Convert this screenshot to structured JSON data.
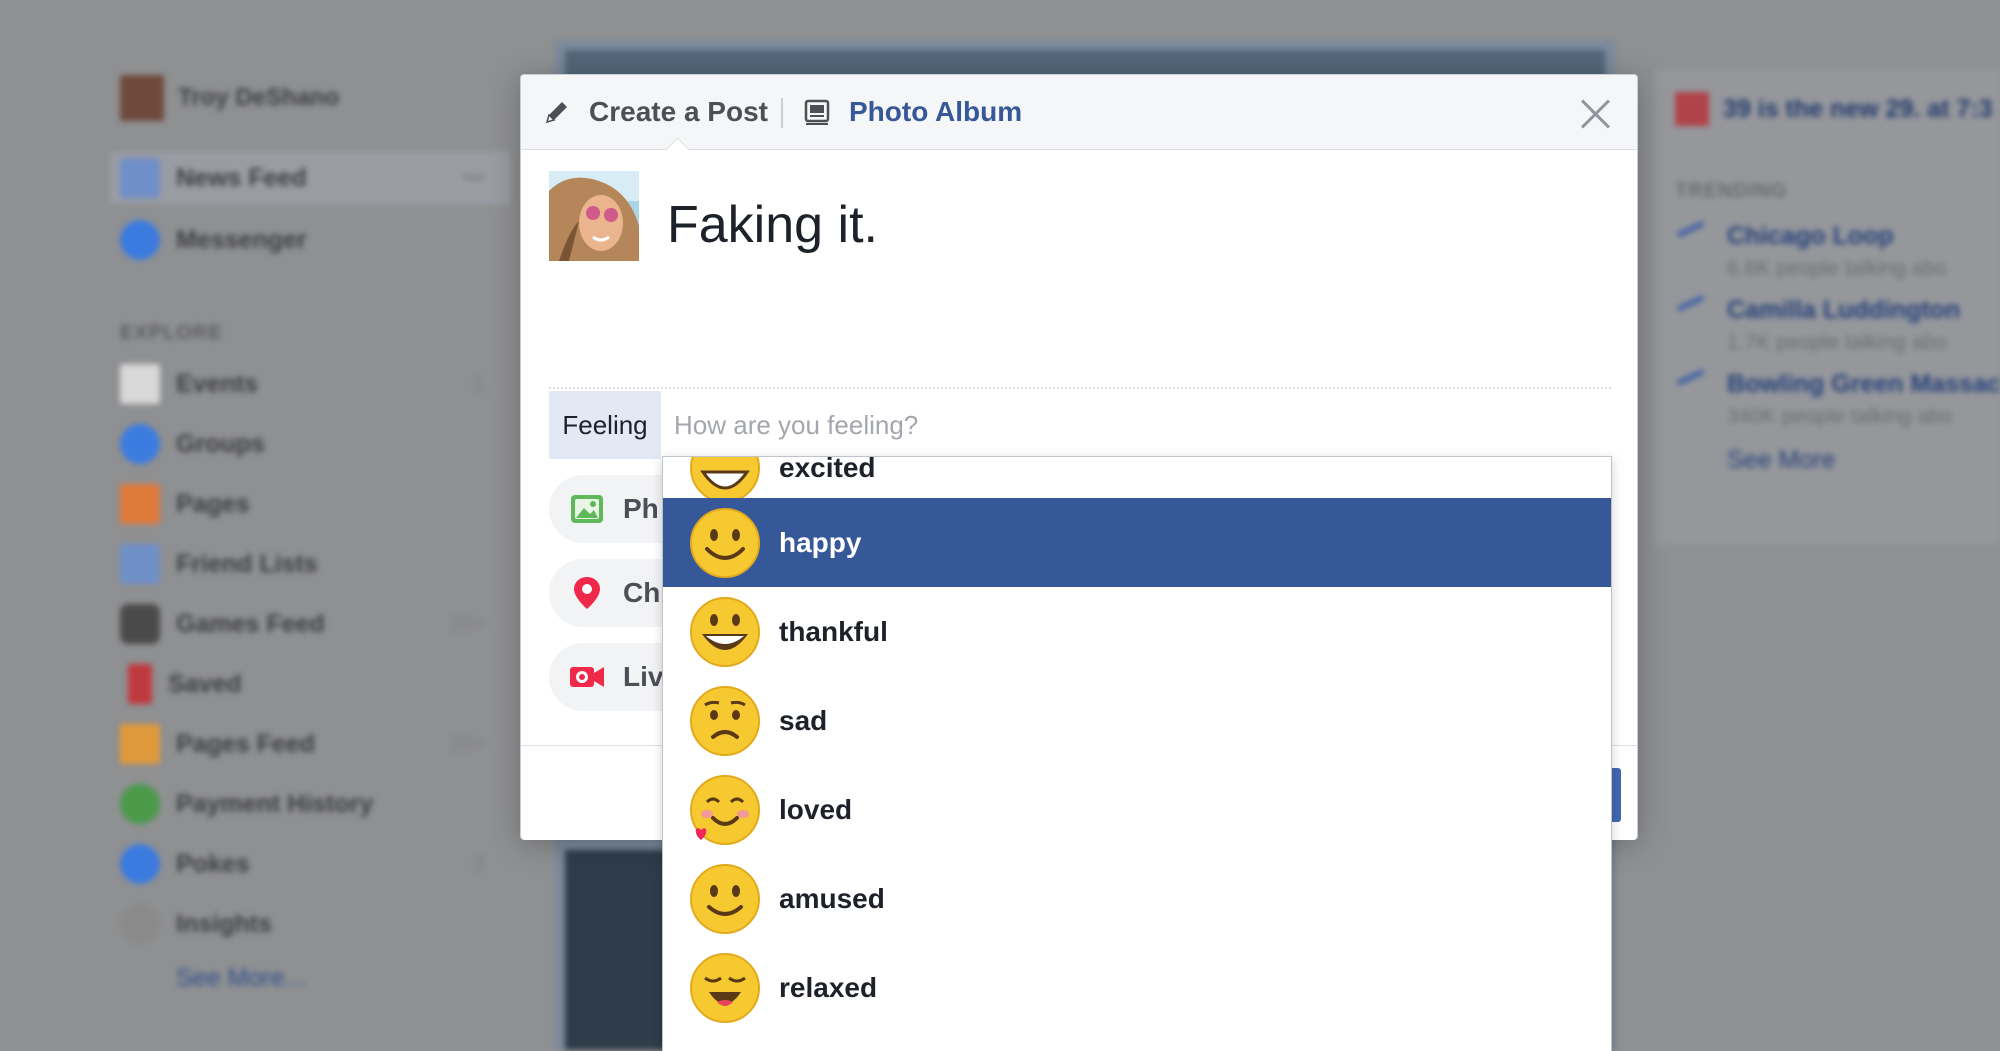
{
  "background": {
    "user_name": "Troy DeShano",
    "nav": [
      {
        "label": "News Feed",
        "count": "•••",
        "color": "#6f8fc8"
      },
      {
        "label": "Messenger",
        "count": "",
        "color": "#3b7be0"
      }
    ],
    "explore_heading": "EXPLORE",
    "explore": [
      {
        "label": "Events",
        "count": "1",
        "color": "#d8d8d8"
      },
      {
        "label": "Groups",
        "count": "",
        "color": "#3b7be0"
      },
      {
        "label": "Pages",
        "count": "",
        "color": "#e07a3b"
      },
      {
        "label": "Friend Lists",
        "count": "",
        "color": "#6f8fc8"
      },
      {
        "label": "Games Feed",
        "count": "20+",
        "color": "#4a4a4a"
      },
      {
        "label": "Saved",
        "count": "",
        "color": "#c0393f"
      },
      {
        "label": "Pages Feed",
        "count": "20+",
        "color": "#e09a3b"
      },
      {
        "label": "Payment History",
        "count": "",
        "color": "#4a9a4a"
      },
      {
        "label": "Pokes",
        "count": "3",
        "color": "#3b7be0"
      },
      {
        "label": "Insights",
        "count": "",
        "color": "#8a8a8a"
      }
    ],
    "see_more": "See More...",
    "event_text": "39 is the new 29. at 7:3",
    "trending_heading": "TRENDING",
    "trending": [
      {
        "title": "Chicago Loop",
        "sub": "6.8K people talking abo"
      },
      {
        "title": "Camilla Luddington",
        "sub": "1.7K people talking abo"
      },
      {
        "title": "Bowling Green Massac",
        "sub": "340K people talking abo"
      }
    ],
    "trending_see_more": "See More"
  },
  "dialog": {
    "tab_create": "Create a Post",
    "tab_album": "Photo Album",
    "composer_text": "Faking it.",
    "feeling_tag": "Feeling",
    "feeling_placeholder": "How are you feeling?",
    "pills": [
      {
        "label": "Ph",
        "icon": "photo-icon"
      },
      {
        "label": "Ch",
        "icon": "location-pin-icon"
      },
      {
        "label": "Liv",
        "icon": "live-video-icon"
      }
    ]
  },
  "dropdown": {
    "items": [
      {
        "label": "excited",
        "icon": "excited-emoji-icon"
      },
      {
        "label": "happy",
        "icon": "happy-emoji-icon",
        "selected": true
      },
      {
        "label": "thankful",
        "icon": "thankful-emoji-icon"
      },
      {
        "label": "sad",
        "icon": "sad-emoji-icon"
      },
      {
        "label": "loved",
        "icon": "loved-emoji-icon"
      },
      {
        "label": "amused",
        "icon": "amused-emoji-icon"
      },
      {
        "label": "relaxed",
        "icon": "relaxed-emoji-icon"
      }
    ]
  },
  "colors": {
    "accent": "#365899",
    "button": "#4267b2",
    "emoji_yellow": "#f7c931"
  }
}
